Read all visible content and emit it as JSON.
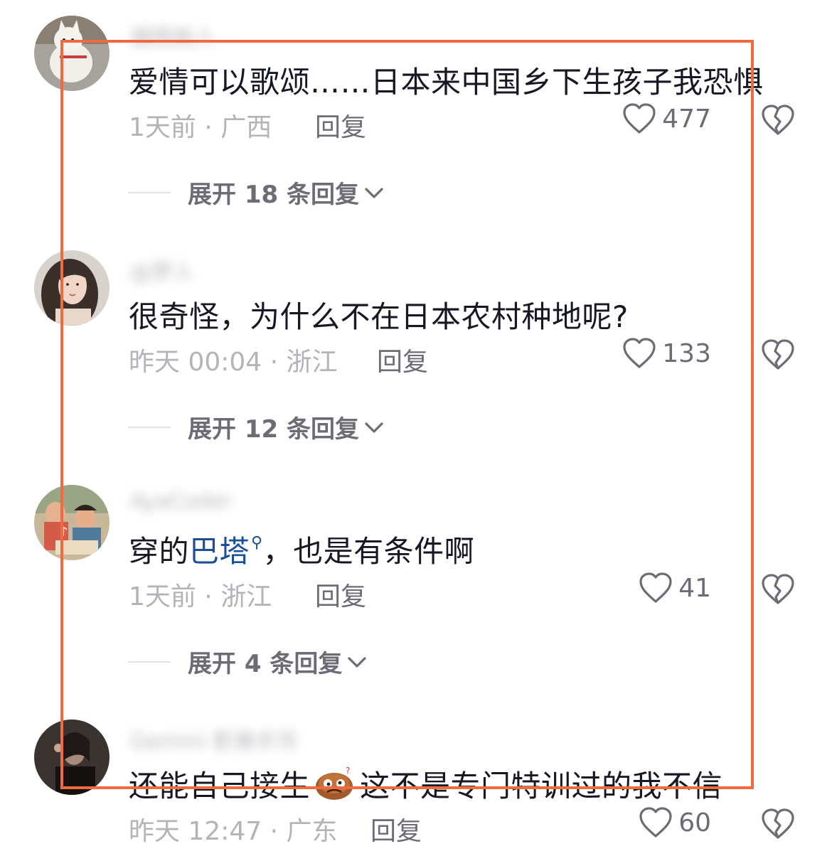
{
  "comments": [
    {
      "username": "烟雨故人",
      "text": "爱情可以歌颂……日本来中国乡下生孩子我恐惧",
      "meta": "1天前 · 广西",
      "reply_label": "回复",
      "likes": "477",
      "expand_label": "展开 18 条回复"
    },
    {
      "username": "@梦人",
      "text": "很奇怪，为什么不在日本农村种地呢?",
      "meta": "昨天 00:04 · 浙江",
      "reply_label": "回复",
      "likes": "133",
      "expand_label": "展开 12 条回复"
    },
    {
      "username": "AyaCoder",
      "text_pre": "穿的",
      "text_link": "巴塔",
      "text_post": "，也是有条件啊",
      "meta": "1天前 · 浙江",
      "reply_label": "回复",
      "likes": "41",
      "expand_label": "展开 4 条回复"
    },
    {
      "username": "Gemini 影像岁月",
      "text_pre": "还能自己接生",
      "text_post": "这不是专门特训过的我不信",
      "meta": "昨天 12:47 · 广东",
      "reply_label": "回复",
      "likes": "60"
    }
  ],
  "icons": {
    "like": "heart-outline-icon",
    "dislike": "broken-heart-icon",
    "expand": "chevron-down-icon",
    "search": "search-icon",
    "emoji": "dizzy-face-emoji-icon"
  },
  "colors": {
    "highlight_border": "#f06a3f",
    "link": "#1b4f9c",
    "text_primary": "#161823",
    "text_secondary": "#6b6c74",
    "text_meta": "#b3b3b8"
  }
}
